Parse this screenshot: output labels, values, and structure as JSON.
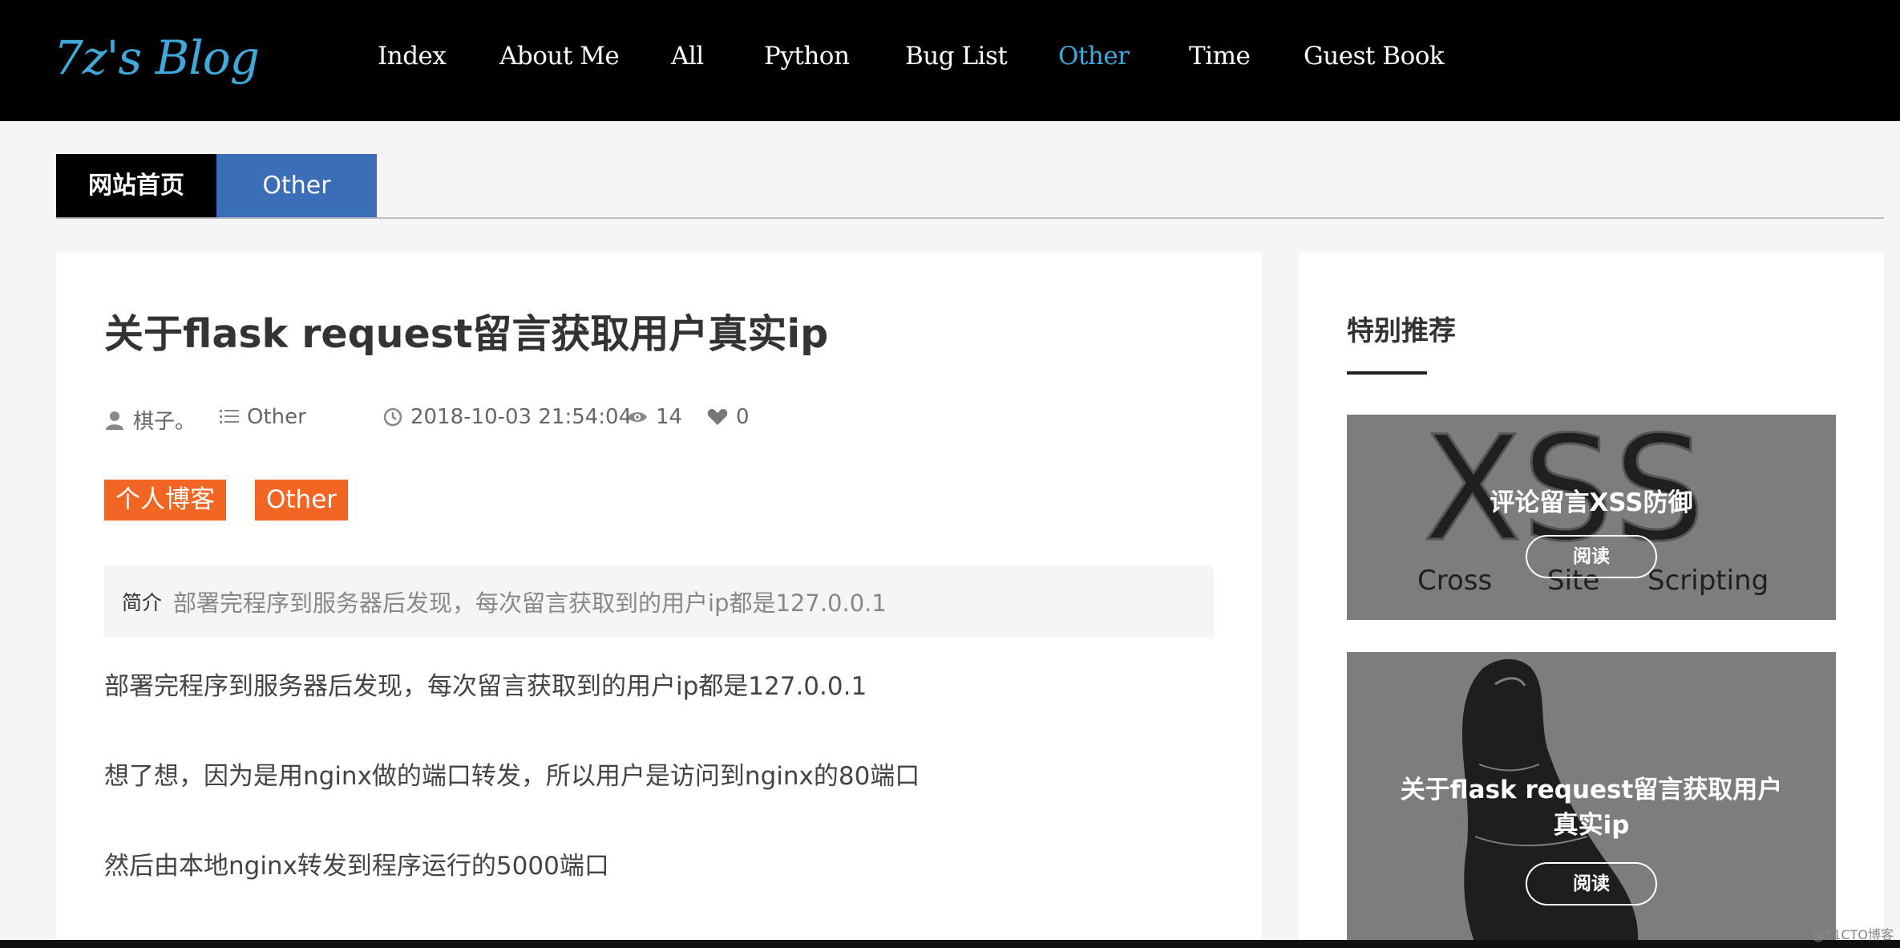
{
  "header": {
    "logo": "7z's Blog",
    "nav": [
      {
        "label": "Index"
      },
      {
        "label": "About Me"
      },
      {
        "label": "All"
      },
      {
        "label": "Python"
      },
      {
        "label": "Bug List"
      },
      {
        "label": "Other"
      },
      {
        "label": "Time"
      },
      {
        "label": "Guest Book"
      }
    ],
    "active_nav": "Other",
    "accent_color": "#3fa9dc"
  },
  "breadcrumb": {
    "home": "网站首页",
    "category": "Other"
  },
  "article": {
    "title": "关于flask request留言获取用户真实ip",
    "meta": {
      "author": "棋子。",
      "category": "Other",
      "datetime": "2018-10-03 21:54:04",
      "views": "14",
      "likes": "0"
    },
    "tags": [
      "个人博客",
      "Other"
    ],
    "summary_label": "简介",
    "summary_text": "部署完程序到服务器后发现，每次留言获取到的用户ip都是127.0.0.1",
    "paragraphs": [
      "部署完程序到服务器后发现，每次留言获取到的用户ip都是127.0.0.1",
      "想了想，因为是用nginx做的端口转发，所以用户是访问到nginx的80端口",
      "然后由本地nginx转发到程序运行的5000端口"
    ]
  },
  "sidebar": {
    "title": "特别推荐",
    "items": [
      {
        "title": "评论留言XSS防御",
        "read_label": "阅读",
        "image_text": {
          "big": "XSS",
          "w1": "Cross",
          "w2": "Site",
          "w3": "Scripting"
        }
      },
      {
        "title_line1": "关于flask request留言获取用户",
        "title_line2": "真实ip",
        "read_label": "阅读"
      }
    ]
  },
  "watermark": "@51CTO博客",
  "colors": {
    "tag": "#f26522",
    "breadcrumb_category": "#3b6db8"
  }
}
